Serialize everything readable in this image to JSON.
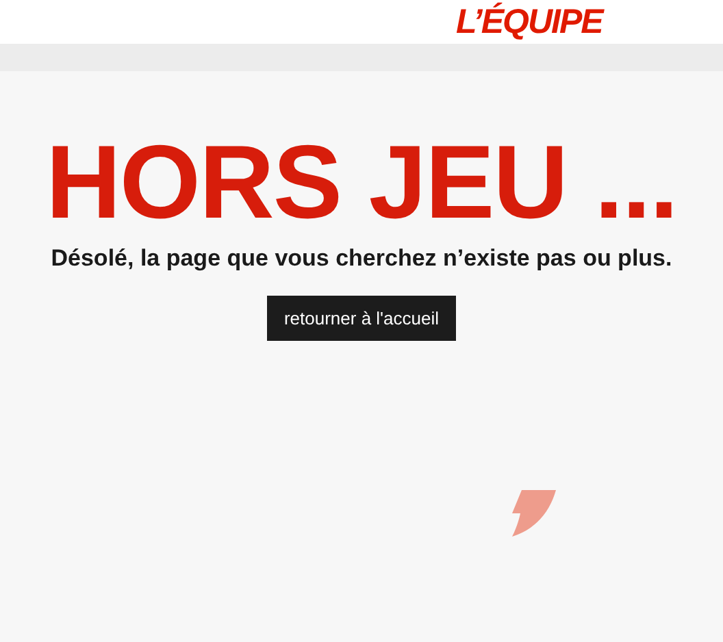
{
  "header": {
    "logo": "L’ÉQUIPE"
  },
  "error": {
    "title": "HORS JEU ...",
    "message": "Désolé, la page que vous cherchez n’existe pas ou plus.",
    "button": "retourner à l'accueil"
  }
}
